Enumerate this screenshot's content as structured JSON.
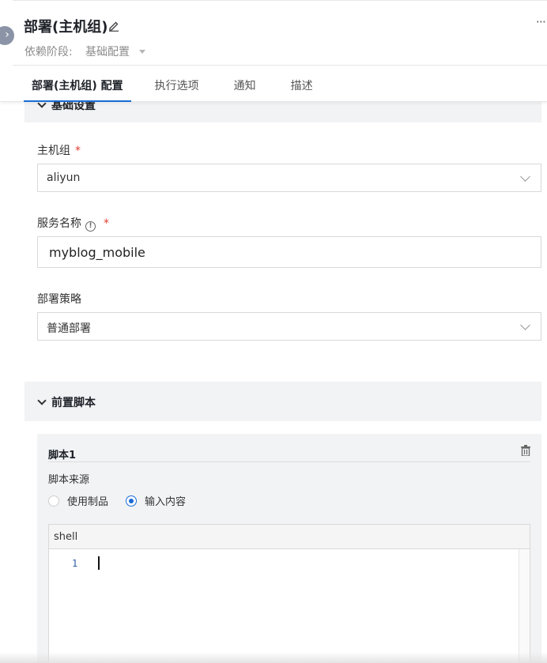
{
  "header": {
    "title": "部署(主机组)",
    "more": "···",
    "dependency_label": "依赖阶段:",
    "dependency_value": "基础配置"
  },
  "tabs": [
    {
      "label": "部署(主机组) 配置",
      "active": true
    },
    {
      "label": "执行选项",
      "active": false
    },
    {
      "label": "通知",
      "active": false
    },
    {
      "label": "描述",
      "active": false
    }
  ],
  "basic_section": {
    "title": "基础设置"
  },
  "fields": {
    "host_group": {
      "label": "主机组",
      "required": "*",
      "value": "aliyun"
    },
    "service_name": {
      "label": "服务名称",
      "required": "*",
      "value": "myblog_mobile"
    },
    "strategy": {
      "label": "部署策略",
      "value": "普通部署"
    }
  },
  "pre_script": {
    "title": "前置脚本",
    "script_title": "脚本1",
    "source_label": "脚本来源",
    "options": [
      {
        "label": "使用制品",
        "selected": false
      },
      {
        "label": "输入内容",
        "selected": true
      }
    ],
    "editor_lang": "shell",
    "line_number": "1"
  },
  "colors": {
    "accent": "#1a6bd6",
    "required": "#e03e2d",
    "section_bg": "#f2f3f5"
  }
}
